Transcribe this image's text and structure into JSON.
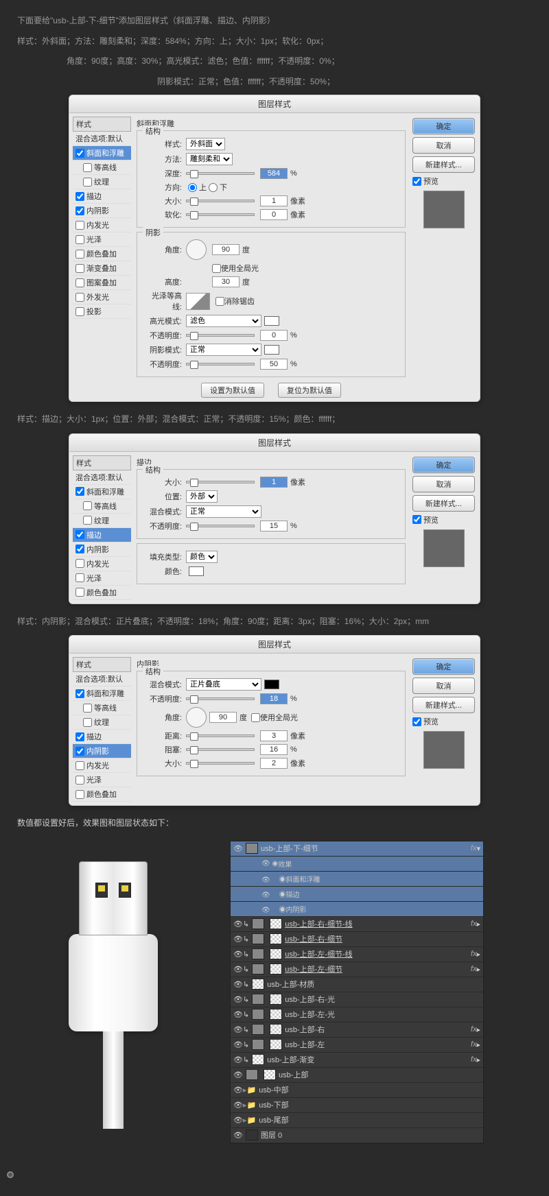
{
  "intro": "下面要给\"usb-上部-下-细节\"添加图层样式（斜面浮雕、描边、内阴影）",
  "params1": "样式：外斜面；方法：雕刻柔和；深度：584%；方向：上；大小：1px；软化：0px；",
  "params2": "　　　　　　角度：90度；高度：30%；高光模式：滤色；色值：ffffff；不透明度：0%；",
  "params3": "　　　　　　　　　　　　　　　　　阴影模式：正常；色值：ffffff；不透明度：50%；",
  "dlgTitle": "图层样式",
  "stylesHeader": "样式",
  "blendOpts": "混合选项:默认",
  "s_bevel": "斜面和浮雕",
  "s_contour": "等高线",
  "s_texture": "纹理",
  "s_stroke": "描边",
  "s_innerShadow": "内阴影",
  "s_innerGlow": "内发光",
  "s_satin": "光泽",
  "s_colorOverlay": "颜色叠加",
  "s_gradOverlay": "渐变叠加",
  "s_patternOverlay": "图案叠加",
  "s_outerGlow": "外发光",
  "s_dropShadow": "投影",
  "bevelTitle": "斜面和浮雕",
  "structTitle": "结构",
  "lbl_style": "样式:",
  "lbl_method": "方法:",
  "lbl_depth": "深度:",
  "lbl_dir": "方向:",
  "lbl_size": "大小:",
  "lbl_soften": "软化:",
  "shadingTitle": "阴影",
  "lbl_angle": "角度:",
  "lbl_alt": "高度:",
  "lbl_gloss": "光泽等高线:",
  "lbl_hilite": "高光模式:",
  "lbl_opacity": "不透明度:",
  "lbl_shadow": "阴影模式:",
  "lbl_blend": "混合模式:",
  "lbl_pos": "位置:",
  "lbl_fill": "填充类型:",
  "lbl_color": "颜色:",
  "lbl_dist": "距离:",
  "lbl_choke": "阻塞:",
  "opt_outer": "外斜面",
  "opt_chisel": "雕刻柔和",
  "opt_screen": "滤色",
  "opt_normal": "正常",
  "opt_multiply": "正片叠底",
  "opt_color": "颜色",
  "opt_outside": "外部",
  "dir_up": "上",
  "dir_down": "下",
  "deg": "度",
  "px": "像素",
  "pct": "%",
  "useGlobal": "使用全局光",
  "antialias": "消除锯齿",
  "v584": "584",
  "v1": "1",
  "v0": "0",
  "v90": "90",
  "v30": "30",
  "v50": "50",
  "v15": "15",
  "v18": "18",
  "v3": "3",
  "v16": "16",
  "v2": "2",
  "btn_default": "设置为默认值",
  "btn_reset": "复位为默认值",
  "btn_ok": "确定",
  "btn_cancel": "取消",
  "btn_newStyle": "新建样式...",
  "preview": "预览",
  "desc_stroke": "样式：描边；大小：1px；位置：外部；混合模式：正常；不透明度：15%；颜色：ffffff；",
  "strokeTitle": "描边",
  "desc_inner": "样式：内阴影；混合模式：正片叠底；不透明度：18%；角度：90度；距离：3px；阻塞：16%；大小：2px；mm",
  "innerTitle": "内阴影",
  "result_text": "数值都设置好后，效果图和图层状态如下：",
  "layers": {
    "l1": "usb-上部-下-细节",
    "fx": "效果",
    "fx1": "斜面和浮雕",
    "fx2": "描边",
    "fx3": "内阴影",
    "l2": "usb-上部-右-细节-线",
    "l3": "usb-上部-右-细节",
    "l4": "usb-上部-左-细节-线",
    "l5": "usb-上部-左-细节",
    "l6": "usb-上部-材质",
    "l7": "usb-上部-右-光",
    "l8": "usb-上部-左-光",
    "l9": "usb-上部-右",
    "l10": "usb-上部-左",
    "l11": "usb-上部-渐变",
    "l12": "usb-上部",
    "l13": "usb-中部",
    "l14": "usb-下部",
    "l15": "usb-尾部",
    "l16": "图层 0",
    "fxTag": "fx"
  }
}
